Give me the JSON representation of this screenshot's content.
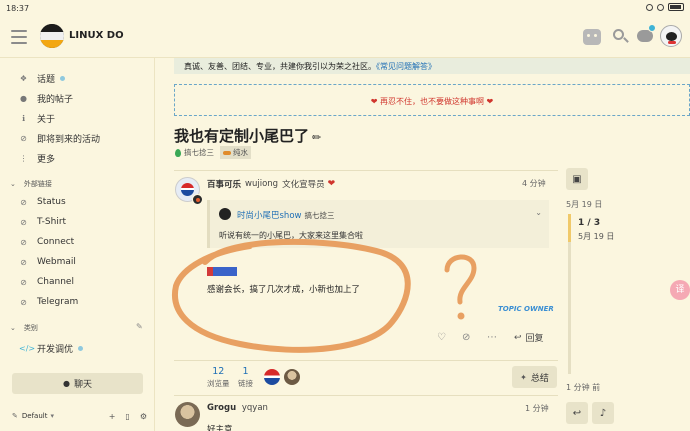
{
  "statusbar": {
    "time": "18:37"
  },
  "header": {
    "site_name": "LINUX DO"
  },
  "sidebar": {
    "items": [
      {
        "label": "话题",
        "icon": "topic-icon",
        "dot": true
      },
      {
        "label": "我的帖子",
        "icon": "user-icon"
      },
      {
        "label": "关于",
        "icon": "info-icon"
      },
      {
        "label": "即将到来的活动",
        "icon": "link-icon"
      },
      {
        "label": "更多",
        "icon": "more-icon"
      }
    ],
    "external_heading": "外部链接",
    "external": [
      {
        "label": "Status",
        "icon": "link-icon"
      },
      {
        "label": "T-Shirt",
        "icon": "link-icon"
      },
      {
        "label": "Connect",
        "icon": "link-icon"
      },
      {
        "label": "Webmail",
        "icon": "link-icon"
      },
      {
        "label": "Channel",
        "icon": "link-icon"
      },
      {
        "label": "Telegram",
        "icon": "link-icon"
      }
    ],
    "categories_heading": "类别",
    "categories": [
      {
        "label": "开发调优",
        "icon": "code-icon",
        "dot": true
      }
    ],
    "chat_label": "聊天",
    "theme_label": "Default"
  },
  "banner": {
    "text": "真诚、友善、团结、专业，共建你我引以为荣之社区。",
    "link": "《常见问题解答》",
    "notice": "再忍不住，也不要做这种事啊"
  },
  "topic": {
    "title": "我也有定制小尾巴了",
    "category": "搞七捻三",
    "tag": "纯水"
  },
  "post1": {
    "name": "百事可乐",
    "username": "wujiong",
    "user_title": "文化宣导员",
    "time": "4 分钟",
    "quote": {
      "author": "时尚小尾巴show",
      "category": "搞七捻三",
      "text": "听说有统一的小尾巴，大家来这里集合啦"
    },
    "body": "感谢会长，搞了几次才成，小新也加上了",
    "owner_badge": "TOPIC OWNER",
    "reply_label": "回复",
    "views": "12",
    "views_label": "浏览量",
    "links": "1",
    "links_label": "链接",
    "summary_label": "总结"
  },
  "post2": {
    "name": "Grogu",
    "username": "yqyan",
    "time": "1 分钟",
    "text": "好主意"
  },
  "timeline": {
    "date_top": "5月 19 日",
    "count": "1 / 3",
    "date": "5月 19 日",
    "ago": "1 分钟 前"
  },
  "annotation": {
    "color": "#e8a062",
    "mark": "?"
  }
}
